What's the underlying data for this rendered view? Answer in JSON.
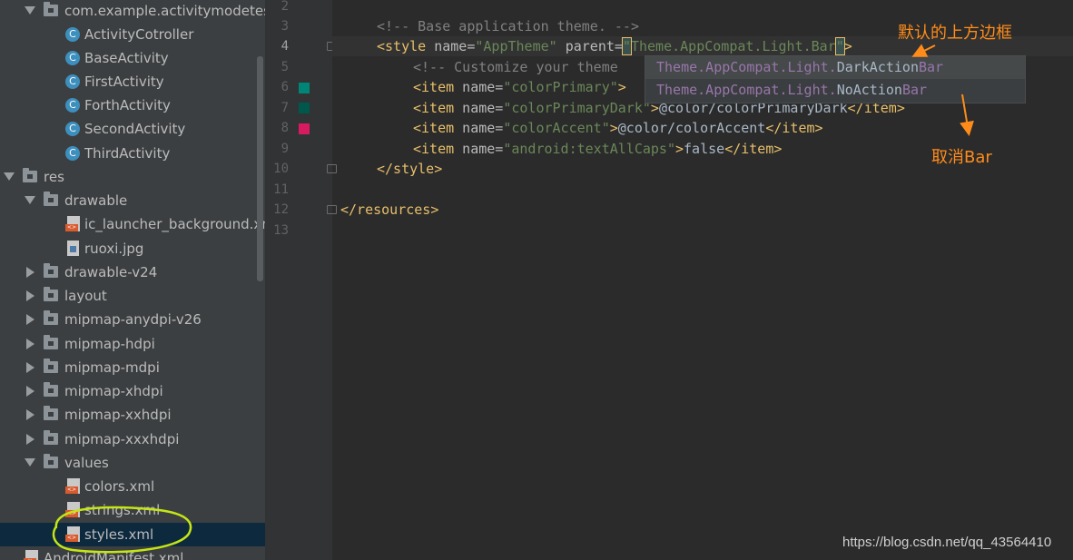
{
  "project_tree": {
    "items": [
      {
        "label": "com.example.activitymodetest",
        "type": "package",
        "expanded": true
      },
      {
        "label": "ActivityCotroller",
        "type": "class"
      },
      {
        "label": "BaseActivity",
        "type": "class"
      },
      {
        "label": "FirstActivity",
        "type": "class"
      },
      {
        "label": "ForthActivity",
        "type": "class"
      },
      {
        "label": "SecondActivity",
        "type": "class"
      },
      {
        "label": "ThirdActivity",
        "type": "class"
      },
      {
        "label": "res",
        "type": "folder",
        "expanded": true
      },
      {
        "label": "drawable",
        "type": "folder",
        "expanded": true
      },
      {
        "label": "ic_launcher_background.xml",
        "type": "xml"
      },
      {
        "label": "ruoxi.jpg",
        "type": "image"
      },
      {
        "label": "drawable-v24",
        "type": "folder",
        "expanded": false
      },
      {
        "label": "layout",
        "type": "folder",
        "expanded": false
      },
      {
        "label": "mipmap-anydpi-v26",
        "type": "folder",
        "expanded": false
      },
      {
        "label": "mipmap-hdpi",
        "type": "folder",
        "expanded": false
      },
      {
        "label": "mipmap-mdpi",
        "type": "folder",
        "expanded": false
      },
      {
        "label": "mipmap-xhdpi",
        "type": "folder",
        "expanded": false
      },
      {
        "label": "mipmap-xxhdpi",
        "type": "folder",
        "expanded": false
      },
      {
        "label": "mipmap-xxxhdpi",
        "type": "folder",
        "expanded": false
      },
      {
        "label": "values",
        "type": "folder",
        "expanded": true
      },
      {
        "label": "colors.xml",
        "type": "xml"
      },
      {
        "label": "strings.xml",
        "type": "xml"
      },
      {
        "label": "styles.xml",
        "type": "xml",
        "selected": true
      },
      {
        "label": "AndroidManifest.xml",
        "type": "xml"
      }
    ]
  },
  "editor": {
    "line_numbers": [
      "2",
      "3",
      "4",
      "5",
      "6",
      "7",
      "8",
      "9",
      "10",
      "11",
      "12",
      "13"
    ],
    "current_line": "4",
    "swatches": [
      {
        "line": "6",
        "color": "#008577"
      },
      {
        "line": "7",
        "color": "#00574B"
      },
      {
        "line": "8",
        "color": "#D81B60"
      }
    ],
    "code": {
      "l3": "<!-- Base application theme. -->",
      "l4_open": "<style",
      "l4_name_attr": " name=",
      "l4_name_val": "\"AppTheme\"",
      "l4_parent_attr": " parent=",
      "l4_quote_open": "\"",
      "l4_parent_val": "Theme.AppCompat.Light.Bar",
      "l4_quote_close": "\"",
      "l4_close": ">",
      "l5": "<!-- Customize your theme",
      "l6_open": "<item",
      "l6_attr": " name=",
      "l6_val": "\"colorPrimary\"",
      "l6_close": ">",
      "l7_open": "<item",
      "l7_attr": " name=",
      "l7_val": "\"colorPrimaryDark\"",
      "l7_gt": ">",
      "l7_text": "@color/colorPrimaryDark",
      "l7_end": "</item>",
      "l8_open": "<item",
      "l8_attr": " name=",
      "l8_val": "\"colorAccent\"",
      "l8_gt": ">",
      "l8_text": "@color/colorAccent",
      "l8_end": "</item>",
      "l9_open": "<item",
      "l9_attr": " name=",
      "l9_val": "\"android:textAllCaps\"",
      "l9_gt": ">",
      "l9_text": "false",
      "l9_end": "</item>",
      "l10": "</style>",
      "l12": "</resources>"
    }
  },
  "autocomplete": {
    "items": [
      {
        "prefix": "Theme.AppCompat.Light.",
        "bold": "DarkAction",
        "suffix": "Bar"
      },
      {
        "prefix": "Theme.AppCompat.Light.",
        "bold": "NoAction",
        "suffix": "Bar"
      }
    ]
  },
  "annotations": {
    "default_label": "默认的上方边框",
    "cancel_label": "取消Bar",
    "color": "#ff8c1a"
  },
  "watermark": "https://blog.csdn.net/qq_43564410"
}
